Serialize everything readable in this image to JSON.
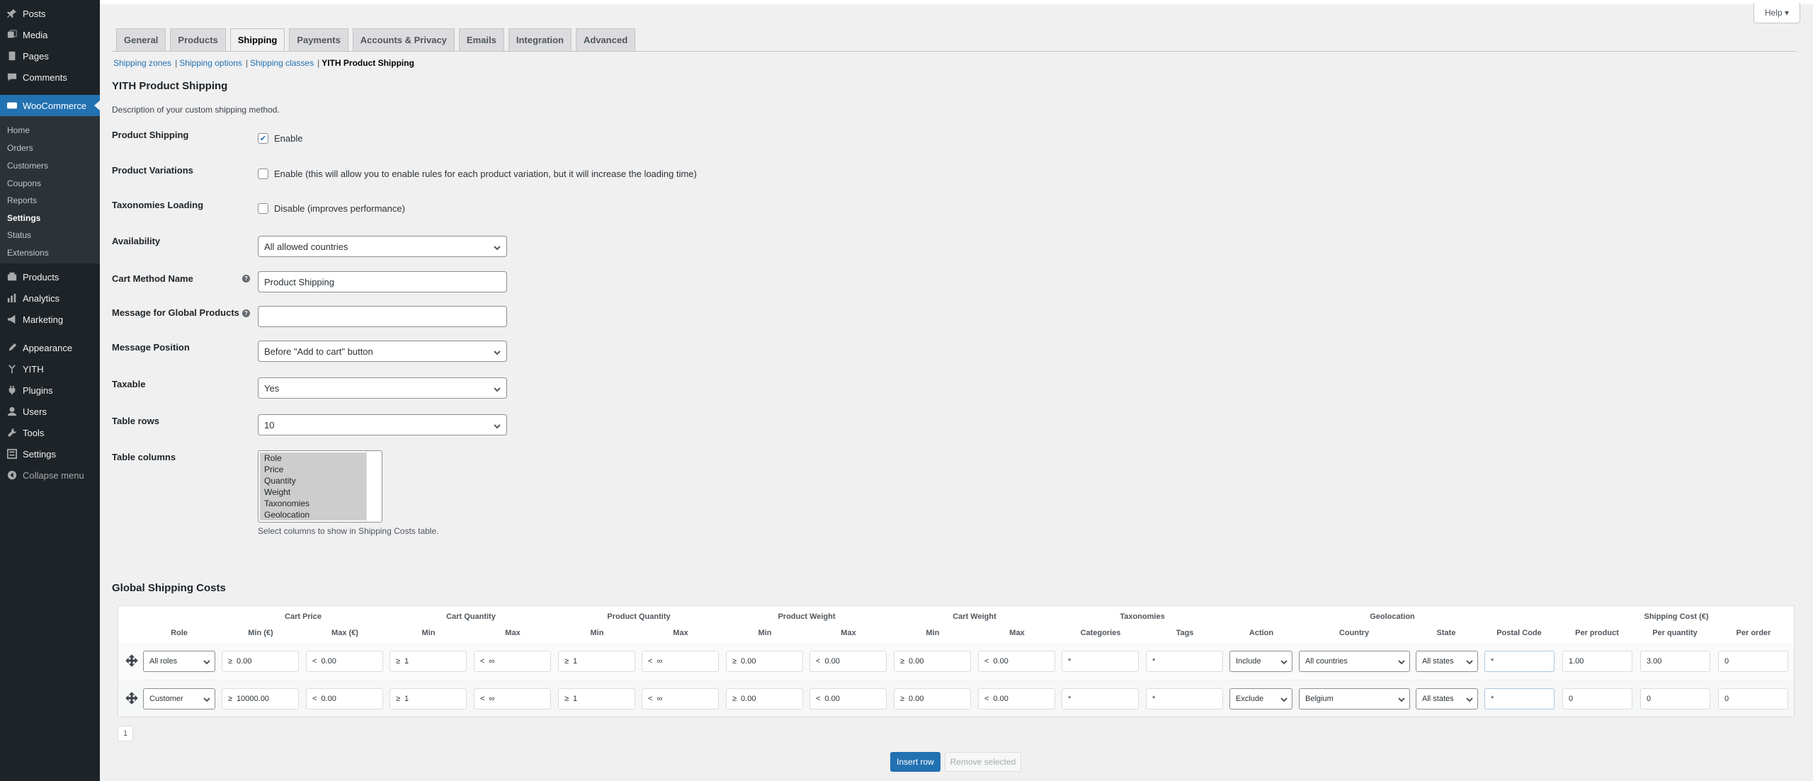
{
  "sidebar": {
    "items": [
      {
        "label": "Posts",
        "icon": "pin-icon"
      },
      {
        "label": "Media",
        "icon": "media-icon"
      },
      {
        "label": "Pages",
        "icon": "pages-icon"
      },
      {
        "label": "Comments",
        "icon": "comments-icon"
      },
      {
        "label": "WooCommerce",
        "icon": "woocommerce-icon"
      },
      {
        "label": "Products",
        "icon": "products-icon"
      },
      {
        "label": "Analytics",
        "icon": "analytics-icon"
      },
      {
        "label": "Marketing",
        "icon": "marketing-icon"
      },
      {
        "label": "Appearance",
        "icon": "appearance-icon"
      },
      {
        "label": "YITH",
        "icon": "yith-icon"
      },
      {
        "label": "Plugins",
        "icon": "plugins-icon"
      },
      {
        "label": "Users",
        "icon": "users-icon"
      },
      {
        "label": "Tools",
        "icon": "tools-icon"
      },
      {
        "label": "Settings",
        "icon": "settings-icon"
      },
      {
        "label": "Collapse menu",
        "icon": "collapse-icon"
      }
    ],
    "submenu": [
      "Home",
      "Orders",
      "Customers",
      "Coupons",
      "Reports",
      "Settings",
      "Status",
      "Extensions"
    ]
  },
  "help": {
    "label": "Help ▾"
  },
  "tabs": [
    "General",
    "Products",
    "Shipping",
    "Payments",
    "Accounts & Privacy",
    "Emails",
    "Integration",
    "Advanced"
  ],
  "subnav": {
    "zones": "Shipping zones",
    "options": "Shipping options",
    "classes": "Shipping classes",
    "current": "YITH Product Shipping",
    "sep": "|"
  },
  "page": {
    "title": "YITH Product Shipping",
    "description": "Description of your custom shipping method."
  },
  "form": {
    "product_shipping": {
      "label": "Product Shipping",
      "text": "Enable",
      "checked": true
    },
    "product_variations": {
      "label": "Product Variations",
      "text": "Enable (this will allow you to enable rules for each product variation, but it will increase the loading time)",
      "checked": false
    },
    "taxonomies_loading": {
      "label": "Taxonomies Loading",
      "text": "Disable (improves performance)",
      "checked": false
    },
    "availability": {
      "label": "Availability",
      "value": "All allowed countries"
    },
    "cart_method_name": {
      "label": "Cart Method Name",
      "value": "Product Shipping"
    },
    "message_global": {
      "label": "Message for Global Products",
      "value": ""
    },
    "message_position": {
      "label": "Message Position",
      "value": "Before \"Add to cart\" button"
    },
    "taxable": {
      "label": "Taxable",
      "value": "Yes"
    },
    "table_rows": {
      "label": "Table rows",
      "value": "10"
    },
    "table_columns": {
      "label": "Table columns",
      "options": [
        "Role",
        "Price",
        "Quantity",
        "Weight",
        "Taxonomies",
        "Geolocation"
      ],
      "description": "Select columns to show in Shipping Costs table."
    }
  },
  "gsc": {
    "title": "Global Shipping Costs",
    "groups": [
      "Cart Price",
      "Cart Quantity",
      "Product Quantity",
      "Product Weight",
      "Cart Weight",
      "Taxonomies",
      "Geolocation",
      "Shipping Cost (€)"
    ],
    "columns": [
      "Role",
      "Min (€)",
      "Max (€)",
      "Min",
      "Max",
      "Min",
      "Max",
      "Min",
      "Max",
      "Min",
      "Max",
      "Categories",
      "Tags",
      "Action",
      "Country",
      "State",
      "Postal Code",
      "Per product",
      "Per quantity",
      "Per order"
    ],
    "rows": [
      {
        "role": "All roles",
        "price_min": "0.00",
        "price_max": "0.00",
        "cq_min": "1",
        "cq_max": "∞",
        "pq_min": "1",
        "pq_max": "∞",
        "pw_min": "0.00",
        "pw_max": "0.00",
        "cw_min": "0.00",
        "cw_max": "0.00",
        "categories": "*",
        "tags": "*",
        "action": "Include",
        "country": "All countries",
        "state": "All states",
        "postal": "*",
        "per_product": "1.00",
        "per_quantity": "3.00",
        "per_order": "0"
      },
      {
        "role": "Customer",
        "price_min": "10000.00",
        "price_max": "0.00",
        "cq_min": "1",
        "cq_max": "∞",
        "pq_min": "1",
        "pq_max": "∞",
        "pw_min": "0.00",
        "pw_max": "0.00",
        "cw_min": "0.00",
        "cw_max": "0.00",
        "categories": "*",
        "tags": "*",
        "action": "Exclude",
        "country": "Belgium",
        "state": "All states",
        "postal": "*",
        "per_product": "0",
        "per_quantity": "0",
        "per_order": "0"
      }
    ],
    "ge": "≥",
    "lt": "<",
    "page": "1",
    "insert_label": "Insert row",
    "remove_label": "Remove selected"
  }
}
